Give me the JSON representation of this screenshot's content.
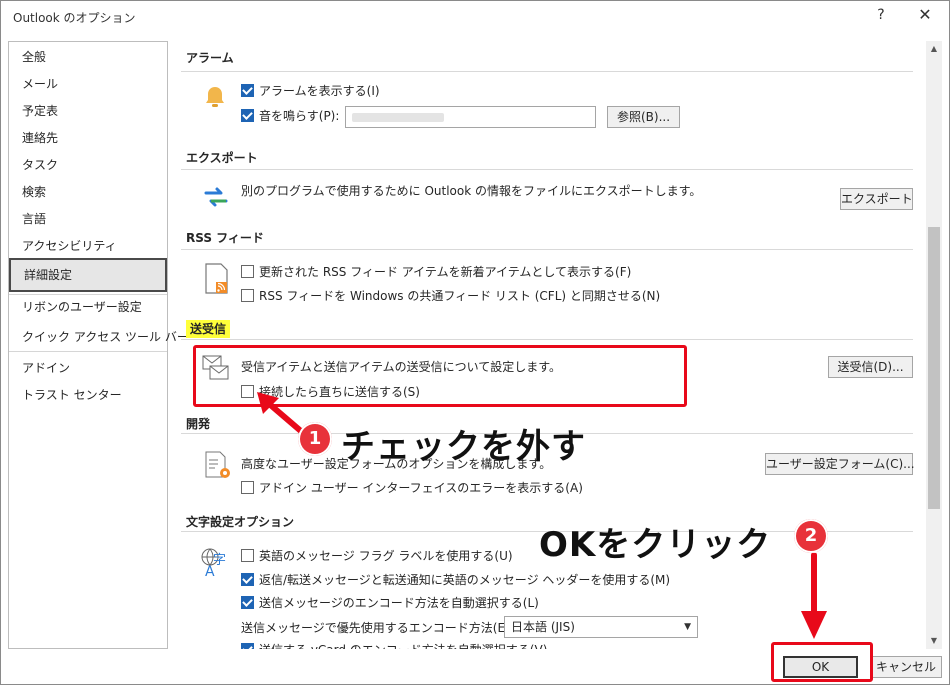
{
  "window": {
    "title": "Outlook のオプション",
    "help_label": "?",
    "close_label": "✕"
  },
  "sidebar": {
    "items": [
      {
        "label": "全般"
      },
      {
        "label": "メール"
      },
      {
        "label": "予定表"
      },
      {
        "label": "連絡先"
      },
      {
        "label": "タスク"
      },
      {
        "label": "検索"
      },
      {
        "label": "言語"
      },
      {
        "label": "アクセシビリティ"
      },
      {
        "label": "詳細設定"
      },
      {
        "label": "リボンのユーザー設定"
      },
      {
        "label": "クイック アクセス ツール バー"
      },
      {
        "label": "アドイン"
      },
      {
        "label": "トラスト センター"
      }
    ],
    "selected": "詳細設定"
  },
  "sections": {
    "alarm": {
      "header": "アラーム",
      "show_alarm": {
        "label": "アラームを表示する(I)",
        "checked": true
      },
      "play_sound": {
        "label": "音を鳴らす(P):",
        "checked": true
      },
      "sound_path": "",
      "browse_label": "参照(B)..."
    },
    "export": {
      "header": "エクスポート",
      "description": "別のプログラムで使用するために Outlook の情報をファイルにエクスポートします。",
      "button_label": "エクスポート"
    },
    "rss": {
      "header": "RSS フィード",
      "item1": {
        "label": "更新された RSS フィード アイテムを新着アイテムとして表示する(F)",
        "checked": false
      },
      "item2": {
        "label": "RSS フィードを Windows の共通フィード リスト (CFL) と同期させる(N)",
        "checked": false
      }
    },
    "send_receive": {
      "header": "送受信",
      "description": "受信アイテムと送信アイテムの送受信について設定します。",
      "send_immediately": {
        "label": "接続したら直ちに送信する(S)",
        "checked": false
      },
      "button_label": "送受信(D)..."
    },
    "developer": {
      "header": "開発",
      "description": "高度なユーザー設定フォームのオプションを構成します。",
      "button_label": "ユーザー設定フォーム(C)...",
      "show_addin_errors": {
        "label": "アドイン ユーザー インターフェイスのエラーを表示する(A)",
        "checked": false
      }
    },
    "international": {
      "header": "文字設定オプション",
      "english_flags": {
        "label": "英語のメッセージ フラグ ラベルを使用する(U)",
        "checked": false
      },
      "english_headers": {
        "label": "返信/転送メッセージと転送通知に英語のメッセージ ヘッダーを使用する(M)",
        "checked": true
      },
      "auto_encoding": {
        "label": "送信メッセージのエンコード方法を自動選択する(L)",
        "checked": true
      },
      "preferred_encoding_label": "送信メッセージで優先使用するエンコード方法(E):",
      "preferred_encoding_value": "日本語 (JIS)",
      "vcard_label": "送信する vCard のエンコード方法を自動選択する(V)"
    }
  },
  "footer": {
    "ok_label": "OK",
    "cancel_label": "キャンセル"
  },
  "annotations": {
    "step1": {
      "number": "1",
      "text": "チェックを外す"
    },
    "step2": {
      "number": "2",
      "text": "OKをクリック"
    },
    "highlight_color": "#e8091a"
  }
}
